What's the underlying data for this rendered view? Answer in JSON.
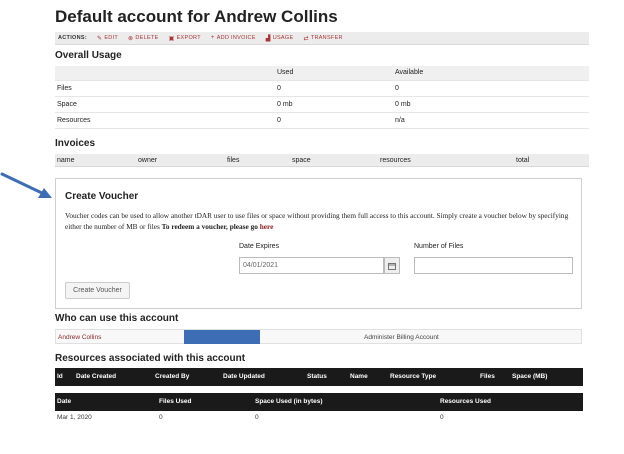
{
  "title": "Default account for Andrew Collins",
  "actions": {
    "label": "ACTIONS:",
    "items": [
      {
        "icon": "pencil-icon",
        "label": "EDIT"
      },
      {
        "icon": "delete-icon",
        "label": "DELETE"
      },
      {
        "icon": "export-icon",
        "label": "EXPORT"
      },
      {
        "icon": "plus-icon",
        "label": "ADD INVOICE"
      },
      {
        "icon": "chart-icon",
        "label": "USAGE"
      },
      {
        "icon": "transfer-icon",
        "label": "TRANSFER"
      }
    ]
  },
  "overall_usage": {
    "title": "Overall Usage",
    "headers": [
      "",
      "Used",
      "Available"
    ],
    "rows": [
      {
        "label": "Files",
        "used": "0",
        "available": "0"
      },
      {
        "label": "Space",
        "used": "0 mb",
        "available": "0 mb"
      },
      {
        "label": "Resources",
        "used": "0",
        "available": "n/a"
      }
    ]
  },
  "invoices": {
    "title": "Invoices",
    "columns": [
      "name",
      "owner",
      "files",
      "space",
      "resources",
      "total"
    ]
  },
  "voucher": {
    "title": "Create Voucher",
    "description": "Voucher codes can be used to allow another tDAR user to use files or space without providing them full access to this account. Simply create a voucher below by specifying either the number of MB or files ",
    "redeem_text": "To redeem a voucher, please go ",
    "redeem_link": "here",
    "date_label": "Date Expires",
    "date_value": "04/01/2021",
    "files_label": "Number of Files",
    "files_value": "",
    "button_label": "Create Voucher"
  },
  "who": {
    "title": "Who can use this account",
    "user": "Andrew Collins",
    "role": "Administer Billing Account"
  },
  "resources": {
    "title": "Resources associated with this account",
    "columns": [
      "Id",
      "Date Created",
      "Created By",
      "Date Updated",
      "Status",
      "Name",
      "Resource Type",
      "Files",
      "Space (MB)"
    ]
  },
  "usage_history": {
    "columns": [
      "Date",
      "Files Used",
      "Space Used (in bytes)",
      "Resources Used"
    ],
    "rows": [
      {
        "date": "Mar 1, 2020",
        "files": "0",
        "space": "0",
        "resources": "0"
      }
    ]
  },
  "colors": {
    "accent": "#8b1a1a",
    "arrow": "#3d6db5",
    "dark_header": "#1a1a1a"
  }
}
